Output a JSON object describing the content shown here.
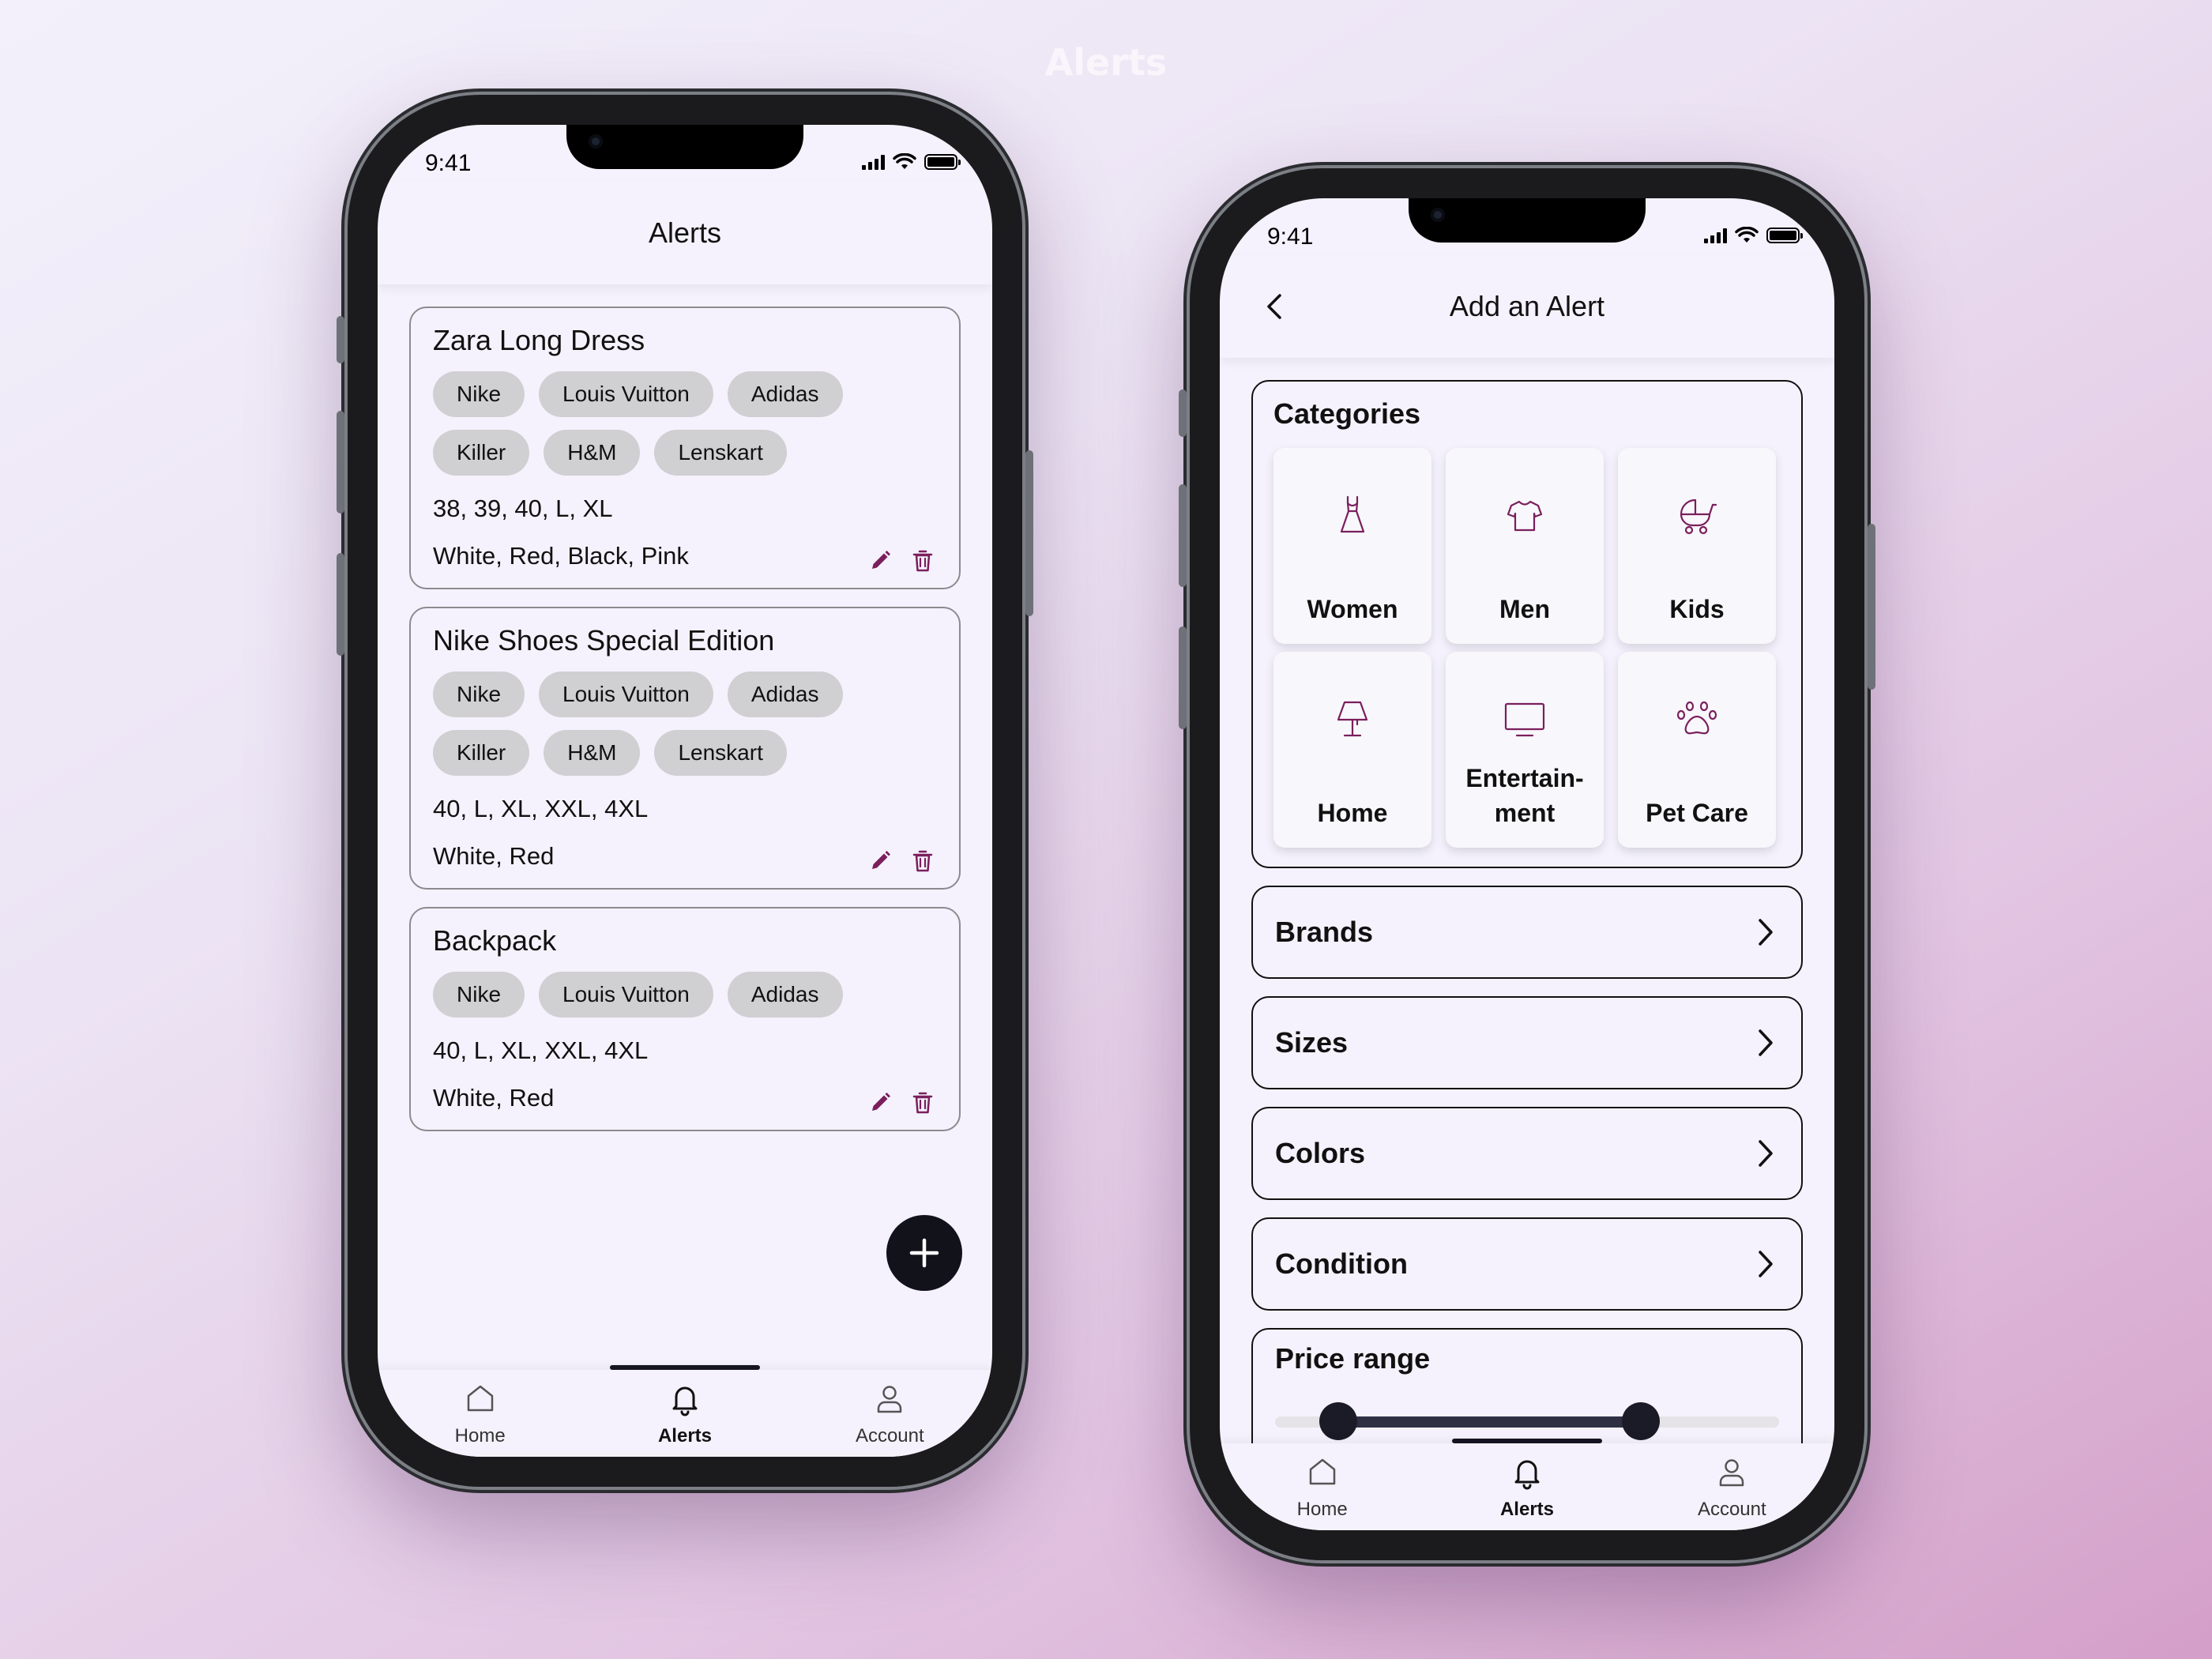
{
  "page": {
    "caption": "Alerts"
  },
  "status_bar": {
    "time": "9:41"
  },
  "colors": {
    "accent": "#7a1f5c",
    "dark": "#151522",
    "chip_bg": "#d0cfd2"
  },
  "alerts_screen": {
    "title": "Alerts",
    "cards": [
      {
        "title": "Zara Long Dress",
        "brands": [
          "Nike",
          "Louis Vuitton",
          "Adidas",
          "Killer",
          "H&M",
          "Lenskart"
        ],
        "sizes": "38, 39, 40, L, XL",
        "colors": "White, Red, Black, Pink"
      },
      {
        "title": "Nike Shoes Special Edition",
        "brands": [
          "Nike",
          "Louis Vuitton",
          "Adidas",
          "Killer",
          "H&M",
          "Lenskart"
        ],
        "sizes": "40, L, XL, XXL, 4XL",
        "colors": "White, Red"
      },
      {
        "title": "Backpack",
        "brands": [
          "Nike",
          "Louis Vuitton",
          "Adidas"
        ],
        "sizes": "40, L, XL, XXL, 4XL",
        "colors": "White, Red"
      }
    ],
    "icons": {
      "edit": "pencil-icon",
      "delete": "trash-icon",
      "add": "plus-icon"
    }
  },
  "add_alert_screen": {
    "title": "Add an Alert",
    "categories_title": "Categories",
    "categories": [
      {
        "label": "Women",
        "icon": "dress-icon"
      },
      {
        "label": "Men",
        "icon": "tshirt-icon"
      },
      {
        "label": "Kids",
        "icon": "stroller-icon"
      },
      {
        "label": "Home",
        "icon": "lamp-icon"
      },
      {
        "label": "Entertain-\nment",
        "icon": "monitor-icon"
      },
      {
        "label": "Pet Care",
        "icon": "paw-icon"
      }
    ],
    "rows": [
      {
        "label": "Brands"
      },
      {
        "label": "Sizes"
      },
      {
        "label": "Colors"
      },
      {
        "label": "Condition"
      }
    ],
    "price_range": {
      "title": "Price range",
      "low_fraction": 0.125,
      "high_fraction": 0.725
    }
  },
  "bottom_nav": {
    "items": [
      {
        "label": "Home",
        "icon": "home-icon"
      },
      {
        "label": "Alerts",
        "icon": "bell-icon",
        "active": true
      },
      {
        "label": "Account",
        "icon": "user-icon"
      }
    ]
  }
}
